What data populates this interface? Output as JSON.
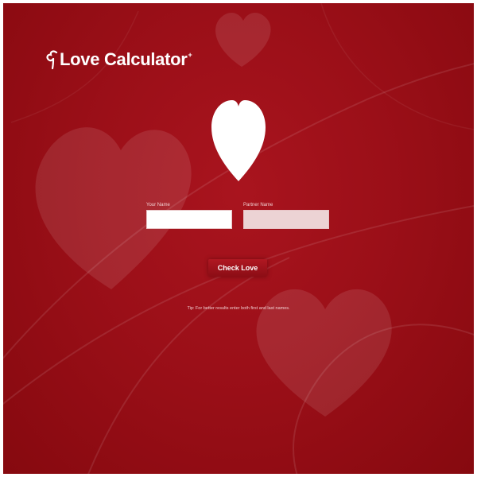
{
  "app": {
    "title": "Love Calculator",
    "title_suffix": "+"
  },
  "form": {
    "your_name_label": "Your Name",
    "your_name_value": "",
    "partner_name_label": "Partner Name",
    "partner_name_value": "",
    "submit_label": "Check Love"
  },
  "tip": "Tip: For better results enter both first and last names.",
  "icons": {
    "logo": "heart-swirl-icon",
    "main": "heart-icon"
  },
  "colors": {
    "background": "#9b0f18",
    "accent": "#ffffff",
    "partner_field": "#ecd3d4"
  }
}
